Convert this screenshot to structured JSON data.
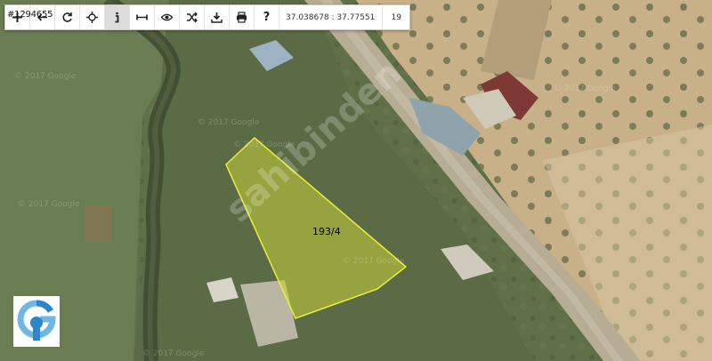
{
  "map": {
    "type": "satellite",
    "parcel_id": "#1294655",
    "parcel_label": "193/4",
    "parcel_outline_color": "#e9ef3c",
    "parcel_fill_color": "#c9d23a",
    "watermark_small": "© 2017 Google",
    "watermark_large": "sahibinden",
    "logo_name": "brand-g-logo"
  },
  "toolbar": {
    "buttons": [
      {
        "name": "add-icon",
        "label": "+"
      },
      {
        "name": "back-icon",
        "label": "←"
      },
      {
        "name": "refresh-icon",
        "label": "↻"
      },
      {
        "name": "locate-icon",
        "label": "⌖"
      },
      {
        "name": "info-icon",
        "label": "i"
      },
      {
        "name": "measure-icon",
        "label": "⟷"
      },
      {
        "name": "view-icon",
        "label": "👁"
      },
      {
        "name": "shuffle-icon",
        "label": "⇄"
      },
      {
        "name": "download-icon",
        "label": "⭳"
      },
      {
        "name": "print-icon",
        "label": "⎙"
      },
      {
        "name": "help-icon",
        "label": "?"
      }
    ],
    "active_button": "info-icon",
    "coordinates": "37.038678 : 37.77551",
    "zoom_level": "19"
  }
}
